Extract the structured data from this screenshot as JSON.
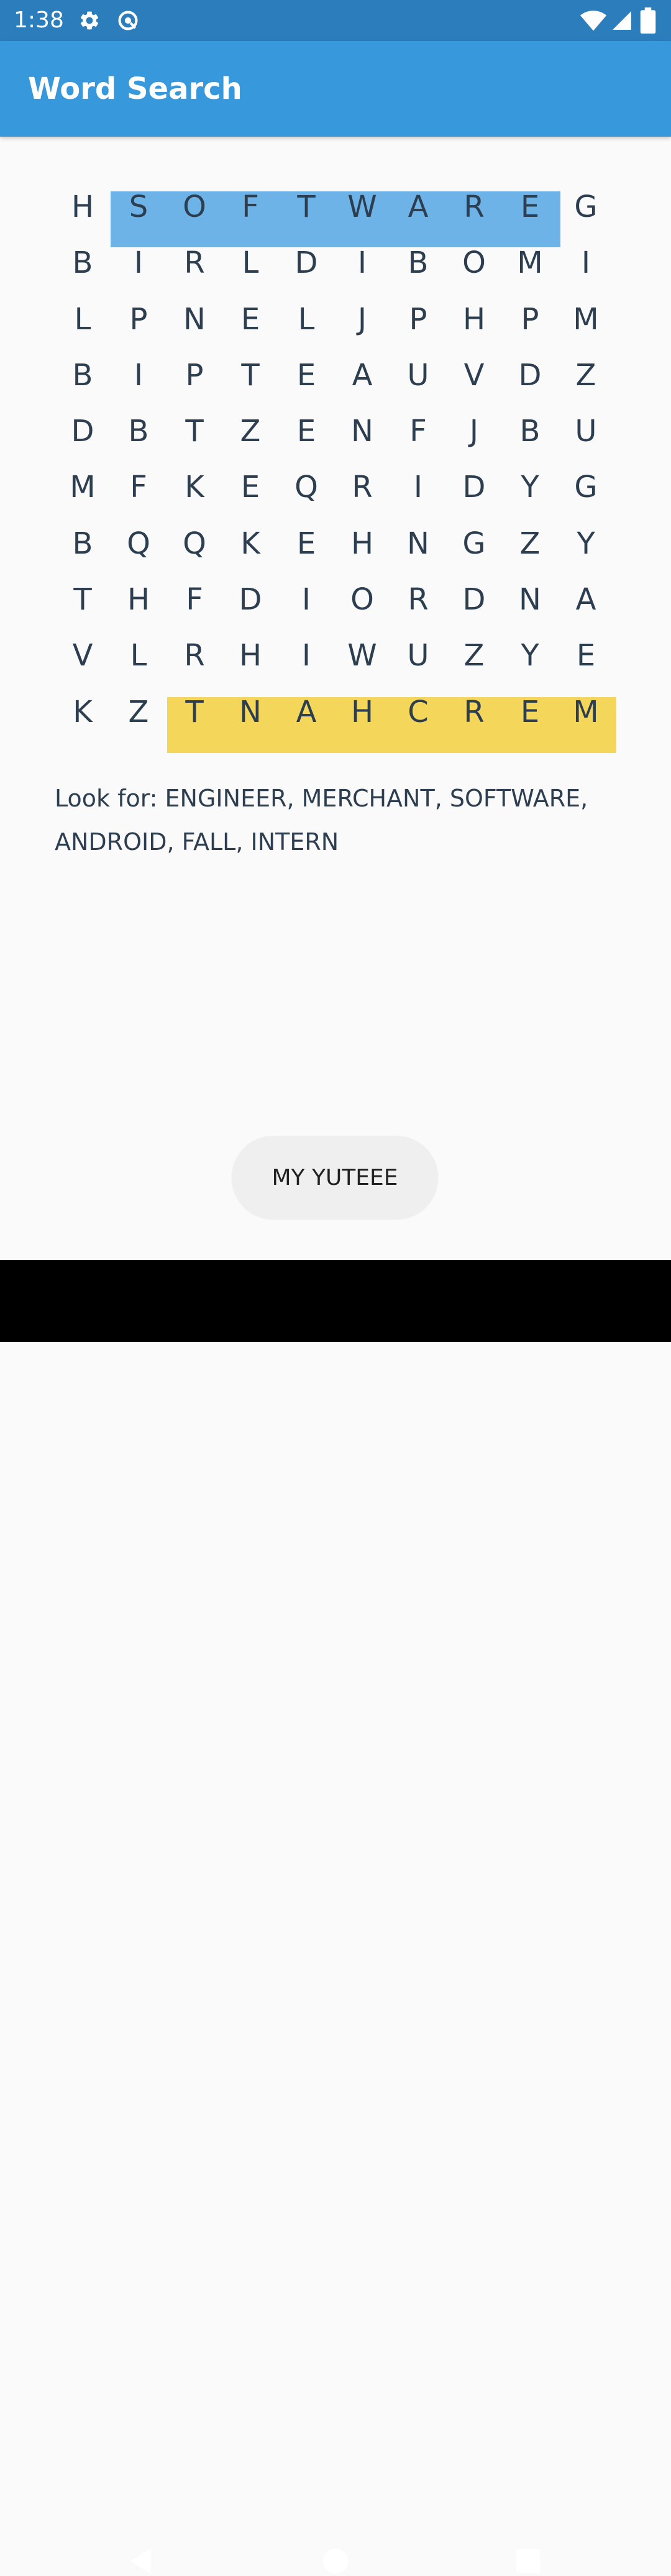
{
  "status_bar": {
    "time": "1:38",
    "icons": [
      "gear-icon",
      "vpn-icon",
      "wifi-icon",
      "cell-signal-icon",
      "battery-icon"
    ]
  },
  "app_bar": {
    "title": "Word Search",
    "color": "#3799dc",
    "status_color": "#2b7dbc"
  },
  "puzzle": {
    "grid": [
      [
        "H",
        "S",
        "O",
        "F",
        "T",
        "W",
        "A",
        "R",
        "E",
        "G"
      ],
      [
        "B",
        "I",
        "R",
        "L",
        "D",
        "I",
        "B",
        "O",
        "M",
        "I"
      ],
      [
        "L",
        "P",
        "N",
        "E",
        "L",
        "J",
        "P",
        "H",
        "P",
        "M"
      ],
      [
        "B",
        "I",
        "P",
        "T",
        "E",
        "A",
        "U",
        "V",
        "D",
        "Z"
      ],
      [
        "D",
        "B",
        "T",
        "Z",
        "E",
        "N",
        "F",
        "J",
        "B",
        "U"
      ],
      [
        "M",
        "F",
        "K",
        "E",
        "Q",
        "R",
        "I",
        "D",
        "Y",
        "G"
      ],
      [
        "B",
        "Q",
        "Q",
        "K",
        "E",
        "H",
        "N",
        "G",
        "Z",
        "Y"
      ],
      [
        "T",
        "H",
        "F",
        "D",
        "I",
        "O",
        "R",
        "D",
        "N",
        "A"
      ],
      [
        "V",
        "L",
        "R",
        "H",
        "I",
        "W",
        "U",
        "Z",
        "Y",
        "E"
      ],
      [
        "K",
        "Z",
        "T",
        "N",
        "A",
        "H",
        "C",
        "R",
        "E",
        "M"
      ]
    ],
    "found_words": [
      {
        "word": "SOFTWARE",
        "row": 0,
        "col_start": 1,
        "col_end": 8,
        "color": "#6db3e8"
      },
      {
        "word": "MERCHANT",
        "row": 9,
        "col_start": 2,
        "col_end": 9,
        "color": "#f4d65a"
      }
    ],
    "instructions": "Look for:  ENGINEER, MERCHANT, SOFTWARE, ANDROID, FALL, INTERN"
  },
  "action_button": {
    "label": "MY YUTEEE"
  },
  "nav_bar": {
    "icons": [
      "back-icon",
      "home-icon",
      "recents-icon"
    ]
  }
}
